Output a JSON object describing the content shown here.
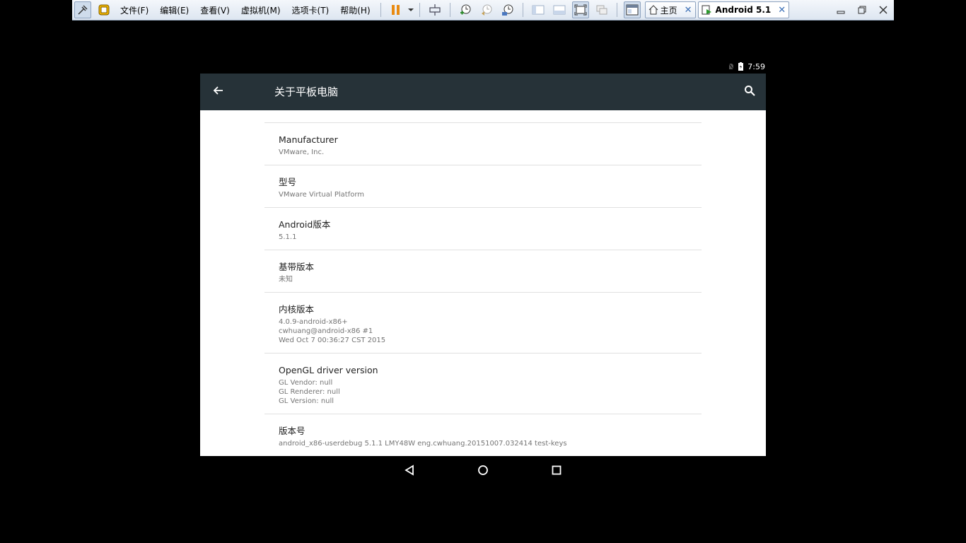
{
  "vmware": {
    "menus": [
      "文件(F)",
      "编辑(E)",
      "查看(V)",
      "虚拟机(M)",
      "选项卡(T)",
      "帮助(H)"
    ],
    "tabs": [
      {
        "label": "主页"
      },
      {
        "label": "Android 5.1"
      }
    ]
  },
  "status_bar": {
    "time": "7:59"
  },
  "app": {
    "title": "关于平板电脑"
  },
  "items": [
    {
      "title": "Manufacturer",
      "summary": "VMware, Inc."
    },
    {
      "title": "型号",
      "summary": "VMware Virtual Platform"
    },
    {
      "title": "Android版本",
      "summary": "5.1.1"
    },
    {
      "title": "基带版本",
      "summary": "未知"
    },
    {
      "title": "内核版本",
      "summary": "4.0.9-android-x86+\ncwhuang@android-x86 #1\nWed Oct 7 00:36:27 CST 2015"
    },
    {
      "title": "OpenGL driver version",
      "summary": "GL Vendor: null\nGL Renderer: null\nGL Version: null"
    },
    {
      "title": "版本号",
      "summary": "android_x86-userdebug 5.1.1 LMY48W eng.cwhuang.20151007.032414 test-keys"
    }
  ],
  "colors": {
    "appbar": "#263238",
    "divider": "#e0e0e0",
    "summary": "#757575"
  }
}
